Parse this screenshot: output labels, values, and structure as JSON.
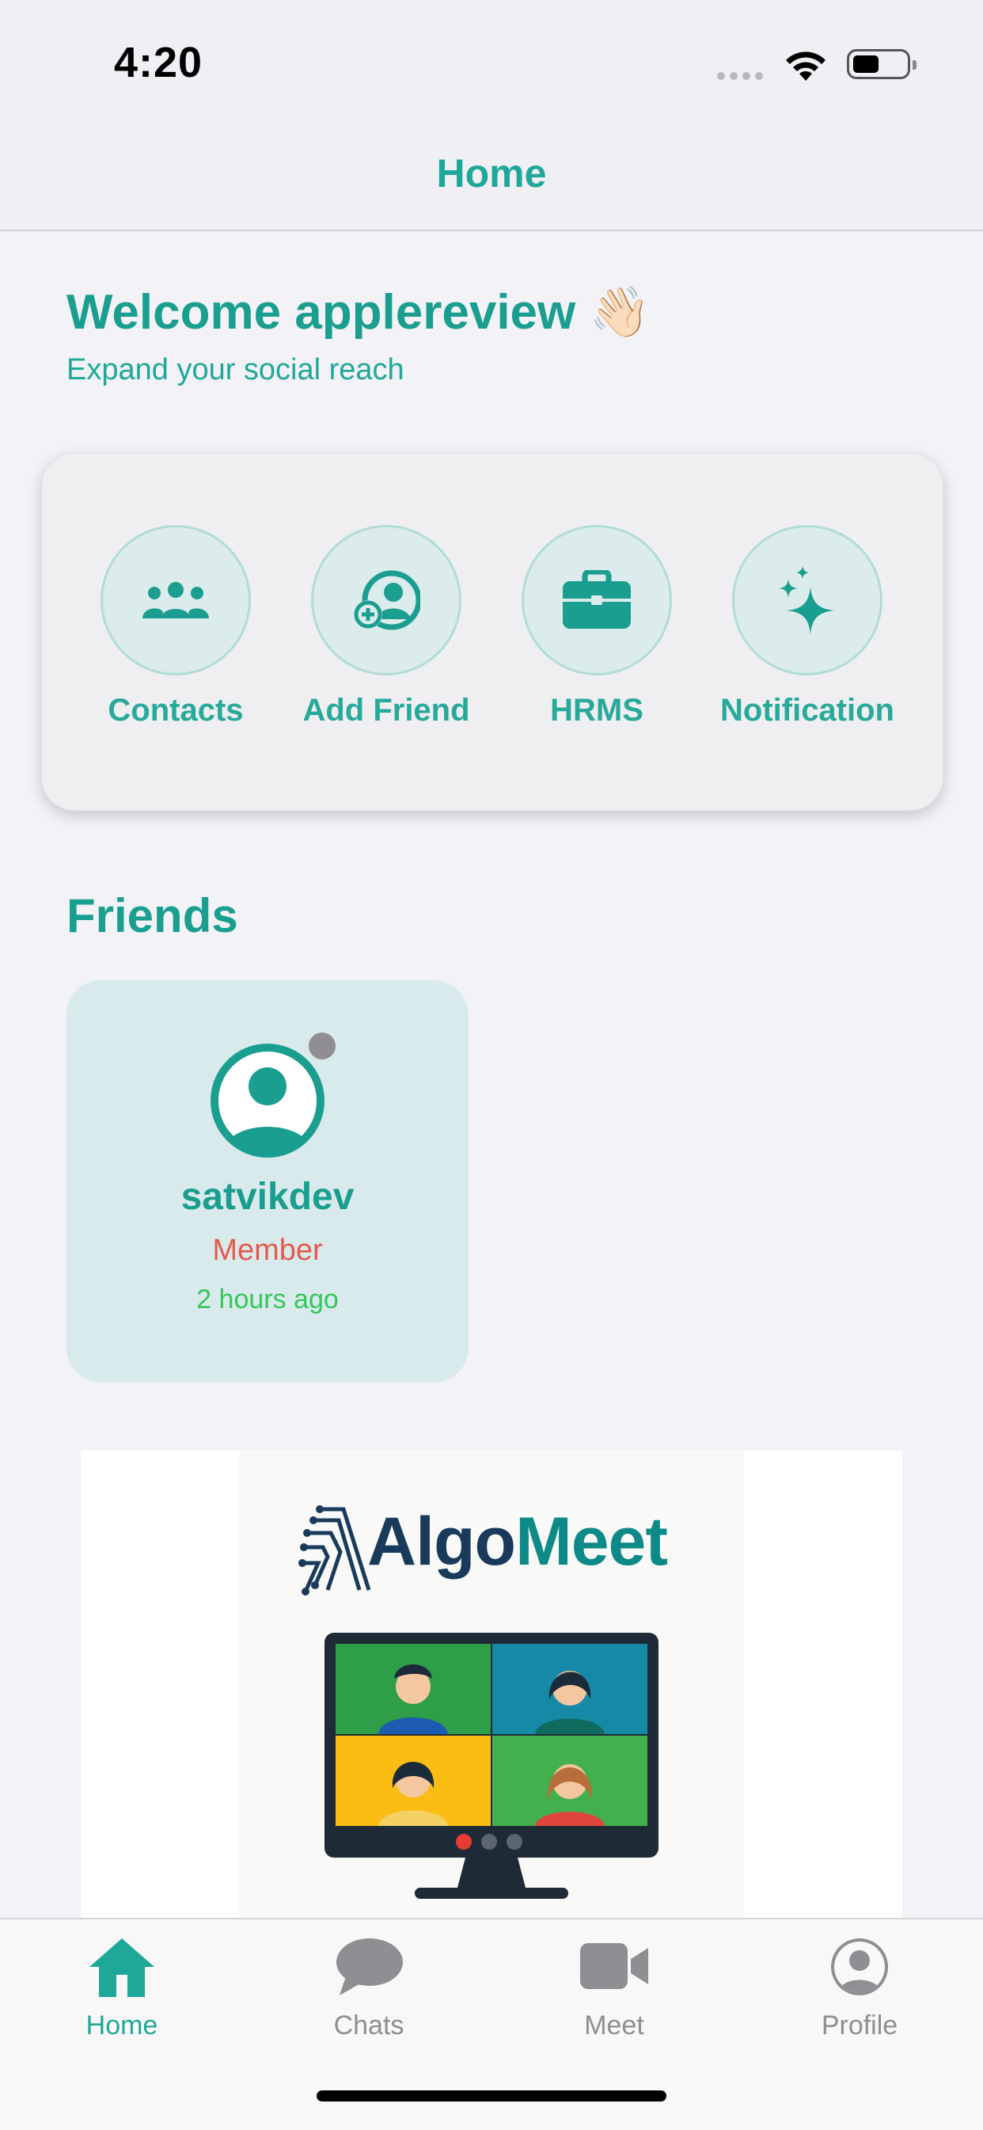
{
  "status_bar": {
    "time": "4:20"
  },
  "nav": {
    "title": "Home"
  },
  "welcome": {
    "title": "Welcome applereview 👋🏻",
    "subtitle": "Expand your social reach"
  },
  "actions": [
    {
      "label": "Contacts",
      "icon": "people-icon"
    },
    {
      "label": "Add Friend",
      "icon": "add-person-icon"
    },
    {
      "label": "HRMS",
      "icon": "briefcase-icon"
    },
    {
      "label": "Notification",
      "icon": "sparkles-icon"
    }
  ],
  "friends": {
    "title": "Friends",
    "items": [
      {
        "name": "satvikdev",
        "role": "Member",
        "last_seen": "2 hours ago",
        "status": "offline"
      }
    ]
  },
  "banner": {
    "brand_part1": "Algo",
    "brand_part2": "Meet"
  },
  "tabbar": {
    "items": [
      {
        "label": "Home",
        "icon": "home-icon",
        "active": true
      },
      {
        "label": "Chats",
        "icon": "chat-bubble-icon",
        "active": false
      },
      {
        "label": "Meet",
        "icon": "video-camera-icon",
        "active": false
      },
      {
        "label": "Profile",
        "icon": "profile-icon",
        "active": false
      }
    ]
  },
  "colors": {
    "accent": "#1fa899",
    "role": "#e25b4c",
    "online": "#34c759"
  }
}
